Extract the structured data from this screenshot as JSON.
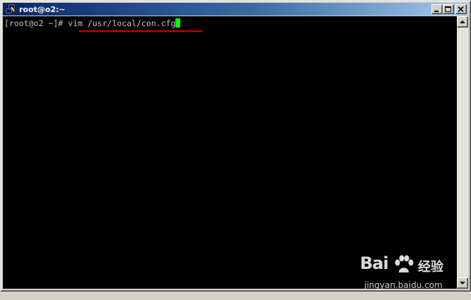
{
  "window": {
    "title": "root@o2:~"
  },
  "terminal": {
    "prompt": "[root@o2 ~]# ",
    "command": "vim /usr/local/con.cfg"
  },
  "watermark": {
    "logo": "Bai  ",
    "brand": "经验",
    "url": "jingyan.baidu.com"
  },
  "colors": {
    "titlebar_start": "#0a246a",
    "titlebar_end": "#a6caf0",
    "terminal_bg": "#000000",
    "terminal_fg": "#c0c0c0",
    "cursor": "#00ff00",
    "annotation_underline": "#d00000"
  },
  "icons": {
    "app": "putty-terminal-icon",
    "minimize": "minimize-icon",
    "maximize": "maximize-icon",
    "close": "close-icon",
    "scroll_up": "arrow-up-icon",
    "scroll_down": "arrow-down-icon"
  }
}
